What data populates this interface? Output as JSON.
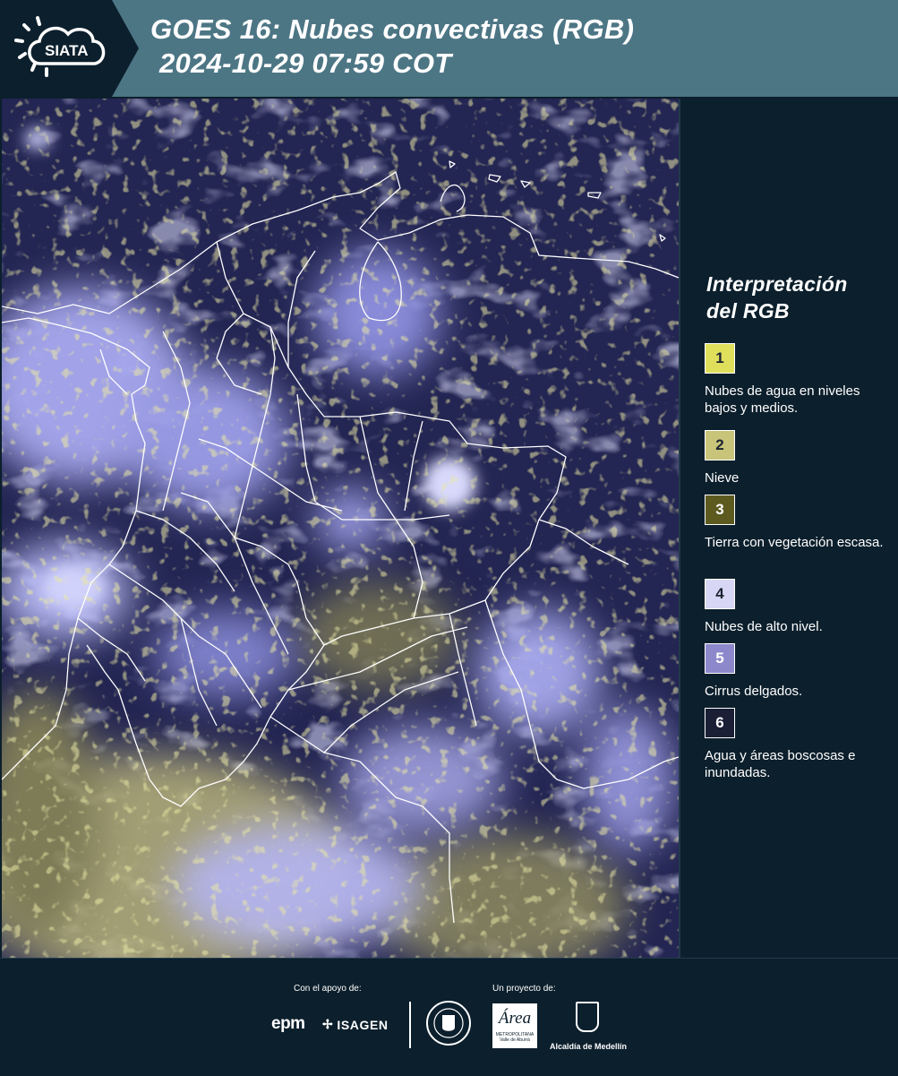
{
  "header": {
    "logo_text": "SIATA",
    "title_line1": "GOES 16: Nubes convectivas (RGB)",
    "title_line2": "2024-10-29 07:59 COT"
  },
  "legend": {
    "title_line1": "Interpretación",
    "title_line2": "del RGB",
    "items": [
      {
        "number": "1",
        "label": "Nubes de agua en niveles bajos y medios.",
        "color": "#e0df5c"
      },
      {
        "number": "2",
        "label": "Nieve",
        "color": "#c8c47a"
      },
      {
        "number": "3",
        "label": "Tierra con vegetación escasa.",
        "color": "#5c5a1f"
      },
      {
        "number": "4",
        "label": "Nubes de alto nivel.",
        "color": "#d8d6f5"
      },
      {
        "number": "5",
        "label": "Cirrus delgados.",
        "color": "#8d88cc"
      },
      {
        "number": "6",
        "label": "Agua y áreas boscosas e inundadas.",
        "color": "#1a1f36"
      }
    ]
  },
  "footer": {
    "support_label": "Con el apoyo de:",
    "project_label": "Un proyecto de:",
    "sponsor_1": "epm",
    "sponsor_2": "ISAGEN",
    "partner_3": "Área",
    "partner_3_sub": "METROPOLITANA Valle de Aburrá",
    "partner_4": "Alcaldía de Medellín"
  },
  "map": {
    "icon": "satellite-image",
    "colors": {
      "background": "#242654",
      "cloud_high": "#b7b8f4",
      "cloud_low": "#c7c46a",
      "boundary": "#ffffff"
    }
  }
}
